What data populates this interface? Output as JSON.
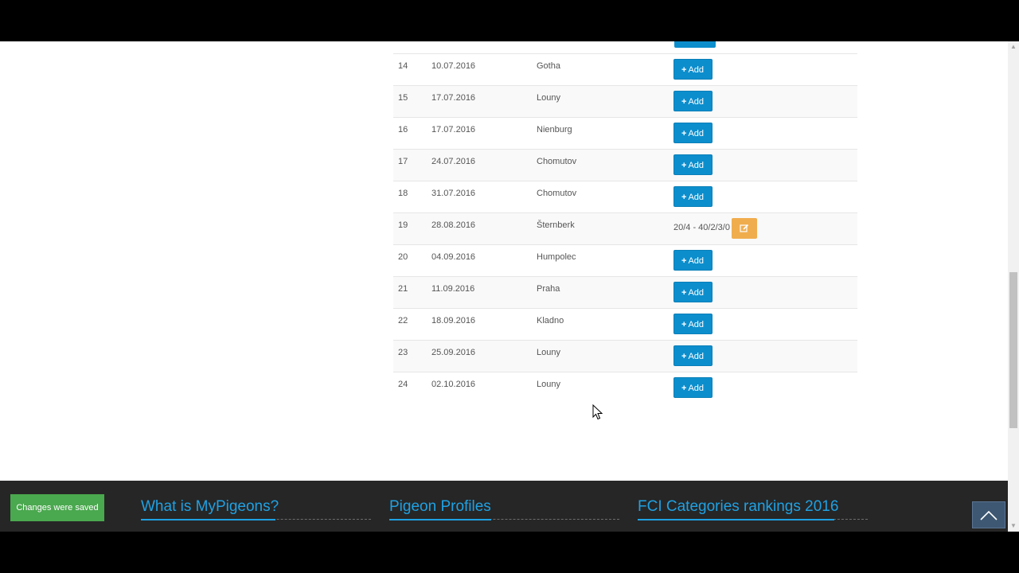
{
  "races": {
    "rows": [
      {
        "num": "14",
        "date": "10.07.2016",
        "place": "Gotha",
        "action": "add"
      },
      {
        "num": "15",
        "date": "17.07.2016",
        "place": "Louny",
        "action": "add"
      },
      {
        "num": "16",
        "date": "17.07.2016",
        "place": "Nienburg",
        "action": "add"
      },
      {
        "num": "17",
        "date": "24.07.2016",
        "place": "Chomutov",
        "action": "add"
      },
      {
        "num": "18",
        "date": "31.07.2016",
        "place": "Chomutov",
        "action": "add"
      },
      {
        "num": "19",
        "date": "28.08.2016",
        "place": "Šternberk",
        "action": "result",
        "result": "20/4 - 40/2/3/0"
      },
      {
        "num": "20",
        "date": "04.09.2016",
        "place": "Humpolec",
        "action": "add"
      },
      {
        "num": "21",
        "date": "11.09.2016",
        "place": "Praha",
        "action": "add"
      },
      {
        "num": "22",
        "date": "18.09.2016",
        "place": "Kladno",
        "action": "add"
      },
      {
        "num": "23",
        "date": "25.09.2016",
        "place": "Louny",
        "action": "add"
      },
      {
        "num": "24",
        "date": "02.10.2016",
        "place": "Louny",
        "action": "add"
      }
    ],
    "add_label": "Add",
    "add_icon": "plus-icon",
    "edit_icon": "edit-icon"
  },
  "footer": {
    "headings": [
      "What is MyPigeons?",
      "Pigeon Profiles",
      "FCI Categories rankings 2016"
    ]
  },
  "toast": {
    "message": "Changes were saved"
  },
  "to_top_icon": "chevron-up-icon",
  "colors": {
    "primary": "#0c8ecd",
    "warning": "#f0ad4e",
    "success": "#4aa84e",
    "footer_bg": "#262626",
    "link": "#1fa1e3"
  }
}
